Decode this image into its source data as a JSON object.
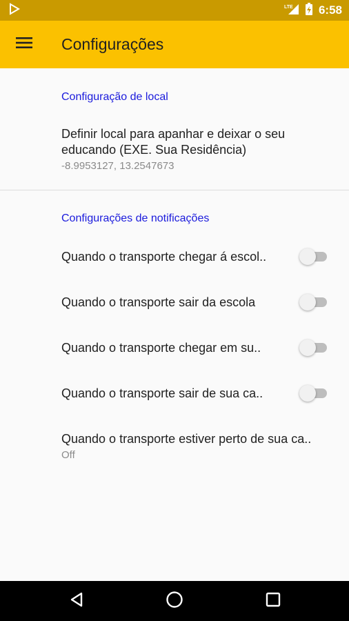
{
  "status_bar": {
    "time": "6:58",
    "network": "LTE",
    "icons": [
      "play-store-icon",
      "lte-signal-icon",
      "battery-charging-icon"
    ]
  },
  "app_bar": {
    "title": "Configurações",
    "menu_icon": "hamburger-menu-icon"
  },
  "location_section": {
    "header": "Configuração de local",
    "item": {
      "title": "Definir local para apanhar e deixar o seu educando (EXE. Sua Residência)",
      "summary": "-8.9953127, 13.2547673"
    }
  },
  "notifications_section": {
    "header": "Configurações de notificações",
    "switches": [
      {
        "label": "Quando o transporte chegar á escol..",
        "checked": false
      },
      {
        "label": "Quando o transporte sair da escola",
        "checked": false
      },
      {
        "label": "Quando o transporte chegar em su..",
        "checked": false
      },
      {
        "label": "Quando o transporte sair de sua ca..",
        "checked": false
      }
    ],
    "proximity": {
      "title": "Quando o transporte estiver perto de sua ca..",
      "summary": "Off"
    }
  },
  "nav_bar": {
    "icons": [
      "back-icon",
      "home-icon",
      "recents-icon"
    ]
  },
  "colors": {
    "app_bar": "#fbc100",
    "status_bar": "#c99a00",
    "section_header": "#1a1adc",
    "background": "#fafafa"
  }
}
